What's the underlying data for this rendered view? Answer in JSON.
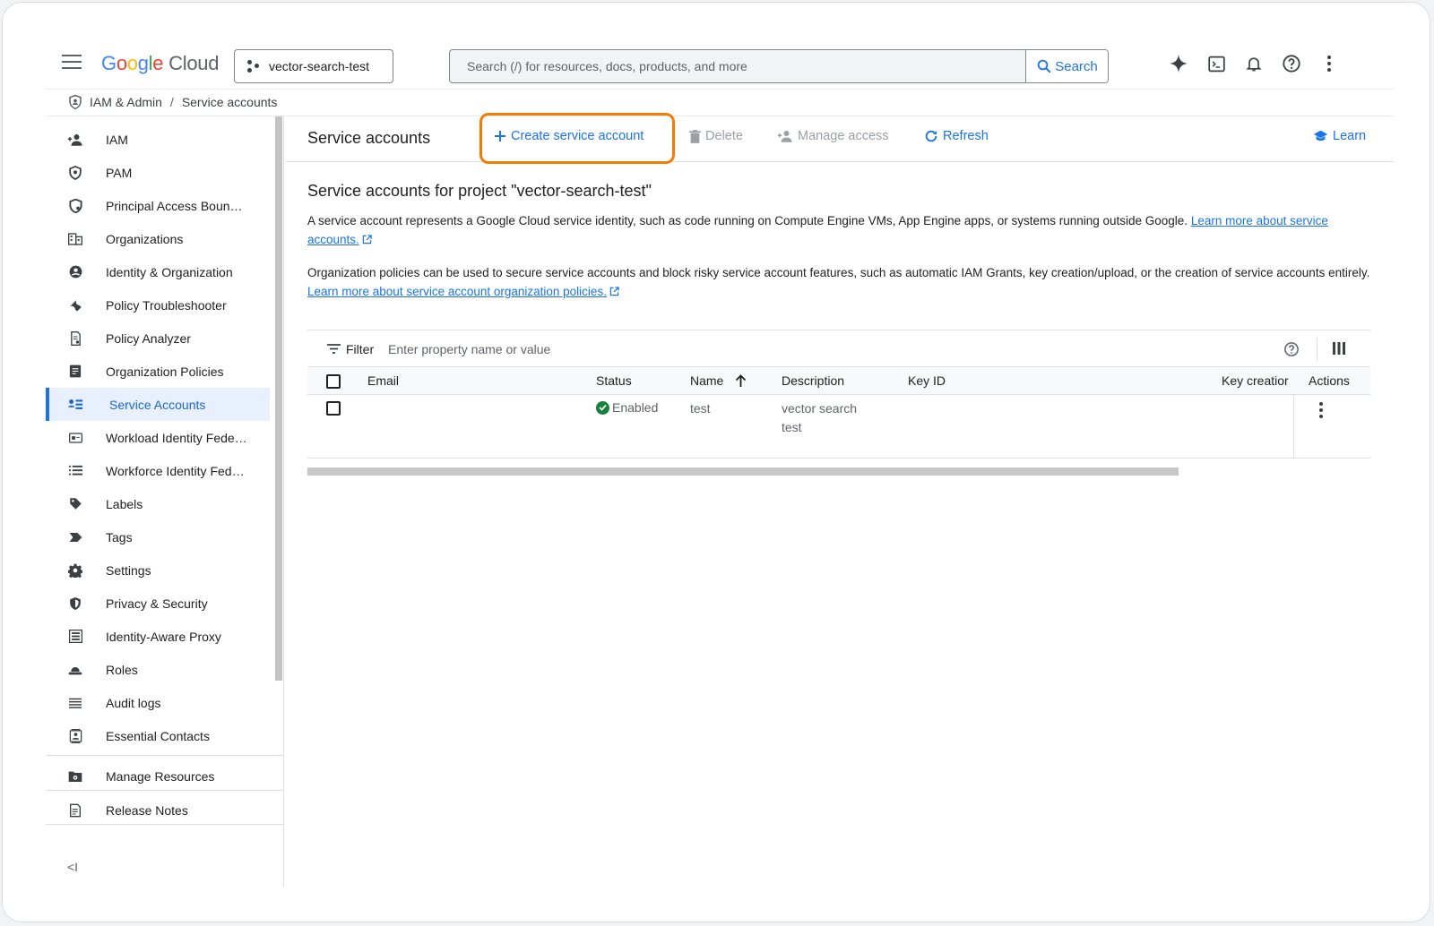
{
  "header": {
    "logo_letters": [
      "G",
      "o",
      "o",
      "g",
      "l",
      "e"
    ],
    "logo_product": "Cloud",
    "project": "vector-search-test",
    "search_placeholder": "Search (/) for resources, docs, products, and more",
    "search_button": "Search"
  },
  "breadcrumb": {
    "section": "IAM & Admin",
    "separator": "/",
    "page": "Service accounts"
  },
  "sidebar": {
    "items": [
      {
        "label": "IAM",
        "icon": "person-add-icon"
      },
      {
        "label": "PAM",
        "icon": "shield-icon"
      },
      {
        "label": "Principal Access Boun…",
        "icon": "shield-search-icon"
      },
      {
        "label": "Organizations",
        "icon": "building-icon"
      },
      {
        "label": "Identity & Organization",
        "icon": "account-circle-icon"
      },
      {
        "label": "Policy Troubleshooter",
        "icon": "wrench-icon"
      },
      {
        "label": "Policy Analyzer",
        "icon": "document-search-icon"
      },
      {
        "label": "Organization Policies",
        "icon": "document-icon"
      },
      {
        "label": "Service Accounts",
        "icon": "service-account-icon",
        "active": true
      },
      {
        "label": "Workload Identity Fede…",
        "icon": "id-card-icon"
      },
      {
        "label": "Workforce Identity Fed…",
        "icon": "list-icon"
      },
      {
        "label": "Labels",
        "icon": "label-icon"
      },
      {
        "label": "Tags",
        "icon": "tag-icon"
      },
      {
        "label": "Settings",
        "icon": "gear-icon"
      },
      {
        "label": "Privacy & Security",
        "icon": "shield-lock-icon"
      },
      {
        "label": "Identity-Aware Proxy",
        "icon": "proxy-icon"
      },
      {
        "label": "Roles",
        "icon": "hat-icon"
      },
      {
        "label": "Audit logs",
        "icon": "lines-icon"
      },
      {
        "label": "Essential Contacts",
        "icon": "contact-icon"
      }
    ],
    "footer_items": [
      {
        "label": "Manage Resources",
        "icon": "folder-gear-icon"
      },
      {
        "label": "Release Notes",
        "icon": "notes-icon"
      }
    ],
    "collapse_label": "<I"
  },
  "toolbar": {
    "title": "Service accounts",
    "create": "Create service account",
    "delete": "Delete",
    "manage_access": "Manage access",
    "refresh": "Refresh",
    "learn": "Learn"
  },
  "content": {
    "heading": "Service accounts for project \"vector-search-test\"",
    "para1_text": "A service account represents a Google Cloud service identity, such as code running on Compute Engine VMs, App Engine apps, or systems running outside Google. ",
    "para1_link": "Learn more about service accounts.",
    "para2_text": "Organization policies can be used to secure service accounts and block risky service account features, such as automatic IAM Grants, key creation/upload, or the creation of service accounts entirely. ",
    "para2_link": "Learn more about service account organization policies."
  },
  "table": {
    "filter_label": "Filter",
    "filter_placeholder": "Enter property name or value",
    "columns": {
      "email": "Email",
      "status": "Status",
      "name": "Name",
      "description": "Description",
      "key_id": "Key ID",
      "key_creation": "Key creatior",
      "actions": "Actions"
    },
    "rows": [
      {
        "email": "",
        "status": "Enabled",
        "name": "test",
        "description_line1": "vector search",
        "description_line2": "test"
      }
    ]
  },
  "colors": {
    "accent": "#1a73e8",
    "highlight": "#f57c00",
    "success": "#188038"
  }
}
